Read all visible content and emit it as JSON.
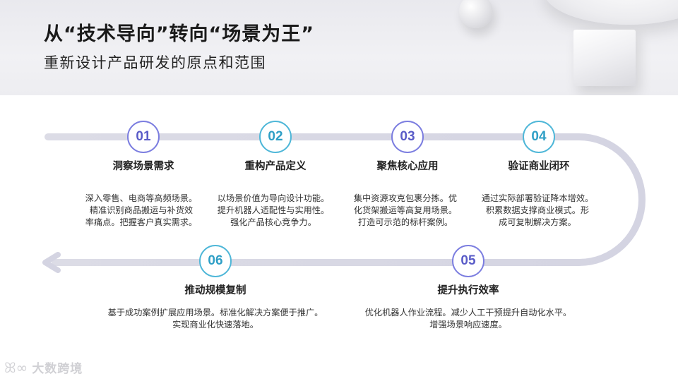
{
  "header": {
    "title": "从“技术导向”转向“场景为王”",
    "subtitle": "重新设计产品研发的原点和范围"
  },
  "steps": [
    {
      "number": "01",
      "title": "洞察场景需求",
      "desc": [
        "深入零售、电商等高频场景。",
        "精准识别商品搬运与补货效",
        "率痛点。把握客户真实需求。"
      ]
    },
    {
      "number": "02",
      "title": "重构产品定义",
      "desc": [
        "以场景价值为导向设计功能。",
        "提升机器人适配性与实用性。",
        "强化产品核心竞争力。"
      ]
    },
    {
      "number": "03",
      "title": "聚焦核心应用",
      "desc": [
        "集中资源攻克包裹分拣。优",
        "化货架搬运等高复用场景。",
        "打造可示范的标杆案例。"
      ]
    },
    {
      "number": "04",
      "title": "验证商业闭环",
      "desc": [
        "通过实际部署验证降本增效。",
        "积累数据支撑商业模式。形",
        "成可复制解决方案。"
      ]
    },
    {
      "number": "05",
      "title": "提升执行效率",
      "desc": [
        "优化机器人作业流程。减少人工干预提升自动化水平。",
        "增强场景响应速度。"
      ]
    },
    {
      "number": "06",
      "title": "推动规模复制",
      "desc": [
        "基于成功案例扩展应用场景。标准化解决方案便于推广。",
        "实现商业化快速落地。"
      ]
    }
  ],
  "logo": {
    "mark": "ꕤ∞",
    "text": "大数跨境"
  }
}
